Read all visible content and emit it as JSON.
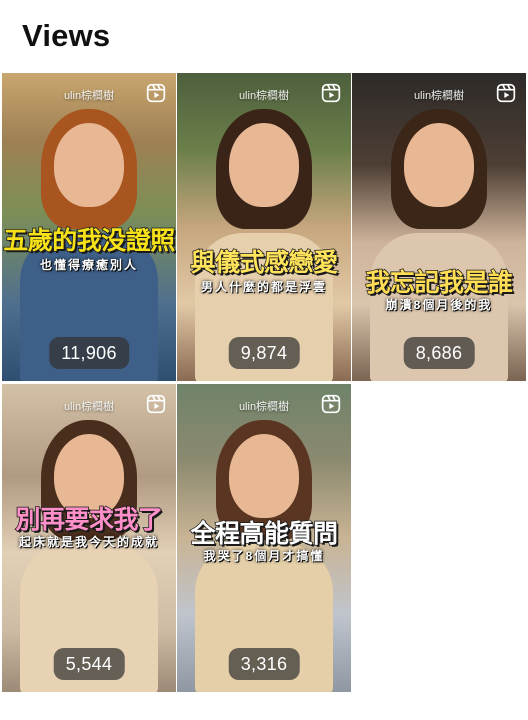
{
  "header": {
    "title": "Views"
  },
  "reels": [
    {
      "watermark": "ulin棕櫚樹",
      "caption_main": "五歲的我没證照",
      "caption_sub": "也懂得療癒別人",
      "views": "11,906",
      "caption_color": "#f7e21a"
    },
    {
      "watermark": "ulin棕櫚樹",
      "caption_main": "與儀式感戀愛",
      "caption_sub": "男人什麼的都是浮雲",
      "views": "9,874",
      "caption_color": "#ffe35a"
    },
    {
      "watermark": "ulin棕櫚樹",
      "caption_main": "我忘記我是誰",
      "caption_sub": "崩潰8個月後的我",
      "views": "8,686",
      "caption_color": "#ffdd55"
    },
    {
      "watermark": "ulin棕櫚樹",
      "caption_main": "別再要求我了",
      "caption_sub": "起床就是我今天的成就",
      "views": "5,544",
      "caption_color": "#ff8fc8"
    },
    {
      "watermark": "ulin棕櫚樹",
      "caption_main": "全程高能質問",
      "caption_sub": "我哭了8個月才搞懂",
      "views": "3,316",
      "caption_color": "#ffffff"
    }
  ],
  "icons": {
    "reel": "reels-icon"
  }
}
